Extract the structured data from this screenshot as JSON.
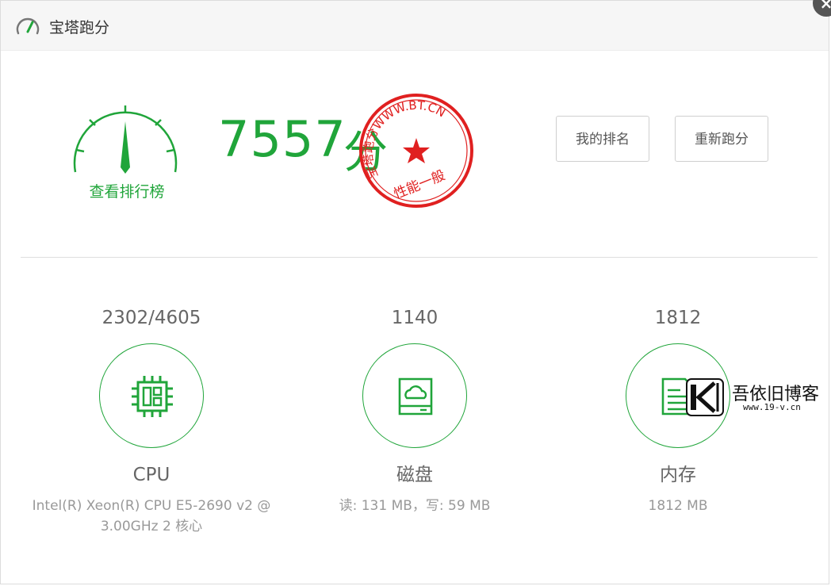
{
  "window": {
    "title": "宝塔跑分",
    "close_glyph": "×",
    "icon": "speedometer-icon"
  },
  "score": {
    "value": "7557",
    "unit": "分",
    "rank_link": "查看排行榜",
    "gauge_icon": "gauge-icon"
  },
  "stamp": {
    "ring_text": "宝塔跑分WWW.BT.CN",
    "level_text": "性能一般",
    "color": "#e02020"
  },
  "buttons": {
    "my_rank": "我的排名",
    "rerun": "重新跑分"
  },
  "items": {
    "cpu": {
      "value": "2302/4605",
      "name": "CPU",
      "desc": "Intel(R) Xeon(R) CPU E5-2690 v2 @ 3.00GHz 2 核心",
      "icon": "cpu-icon"
    },
    "disk": {
      "value": "1140",
      "name": "磁盘",
      "desc": "读: 131 MB，写: 59 MB",
      "icon": "disk-icon"
    },
    "mem": {
      "value": "1812",
      "name": "内存",
      "desc": "1812 MB",
      "icon": "memory-icon"
    }
  },
  "watermark": {
    "name": "吾依旧博客",
    "url": "www.19-v.cn"
  },
  "colors": {
    "accent": "#20a53a",
    "stamp": "#e02020"
  }
}
